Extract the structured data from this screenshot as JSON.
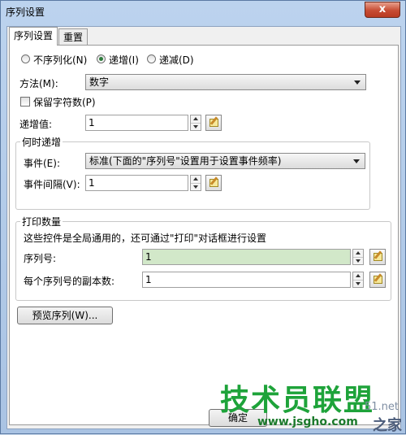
{
  "window": {
    "title": "序列设置",
    "close_glyph": "x"
  },
  "tabs": [
    {
      "label": "序列设置",
      "active": true
    },
    {
      "label": "重置",
      "active": false
    }
  ],
  "mode": {
    "options": [
      {
        "label": "不序列化(N)",
        "selected": false
      },
      {
        "label": "递增(I)",
        "selected": true
      },
      {
        "label": "递减(D)",
        "selected": false
      }
    ]
  },
  "method": {
    "label": "方法(M):",
    "value": "数字"
  },
  "keep_chars": {
    "label": "保留字符数(P)",
    "checked": false
  },
  "increment": {
    "label": "递增值:",
    "value": "1"
  },
  "when": {
    "group_label": "何时递增",
    "event_label": "事件(E):",
    "event_value": "标准(下面的\"序列号\"设置用于设置事件频率)",
    "interval_label": "事件间隔(V):",
    "interval_value": "1"
  },
  "print": {
    "group_label": "打印数量",
    "note": "这些控件是全局通用的，还可通过\"打印\"对话框进行设置",
    "serial_label": "序列号:",
    "serial_value": "1",
    "copies_label": "每个序列号的副本数:",
    "copies_value": "1"
  },
  "preview_button": "预览序列(W)...",
  "bottom_button_partial": "确定",
  "watermark": {
    "title": "技术员联盟",
    "url": "www.jsgho.com",
    "side_text": "51.net",
    "corner_text": "之家"
  },
  "colors": {
    "accent_green": "#d2e8c9",
    "watermark_green": "#1ea33a"
  }
}
